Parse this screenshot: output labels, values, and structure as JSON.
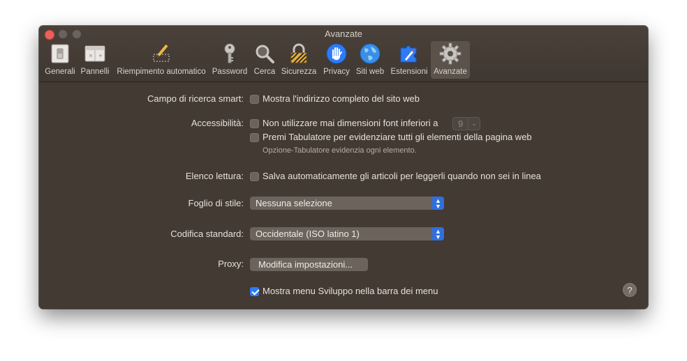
{
  "window": {
    "title": "Avanzate"
  },
  "toolbar": {
    "items": [
      {
        "label": "Generali",
        "icon": "switch-icon"
      },
      {
        "label": "Pannelli",
        "icon": "tabs-window-icon"
      },
      {
        "label": "Riempimento automatico",
        "icon": "pencil-form-icon"
      },
      {
        "label": "Password",
        "icon": "key-icon"
      },
      {
        "label": "Cerca",
        "icon": "magnifier-icon"
      },
      {
        "label": "Sicurezza",
        "icon": "padlock-icon"
      },
      {
        "label": "Privacy",
        "icon": "hand-icon"
      },
      {
        "label": "Siti web",
        "icon": "globe-icon"
      },
      {
        "label": "Estensioni",
        "icon": "puzzle-icon"
      },
      {
        "label": "Avanzate",
        "icon": "gear-icon"
      }
    ],
    "active": "Avanzate"
  },
  "settings": {
    "smart_search": {
      "label": "Campo di ricerca smart:",
      "option": "Mostra l'indirizzo completo del sito web",
      "checked": false
    },
    "accessibility": {
      "label": "Accessibilità:",
      "option_font": "Non utilizzare mai dimensioni font inferiori a",
      "font_size_value": "9",
      "option_font_checked": false,
      "option_tab": "Premi Tabulatore per evidenziare tutti gli elementi della pagina web",
      "option_tab_checked": false,
      "hint": "Opzione-Tabulatore evidenzia ogni elemento."
    },
    "reading_list": {
      "label": "Elenco lettura:",
      "option": "Salva automaticamente gli articoli per leggerli quando non sei in linea",
      "checked": false
    },
    "stylesheet": {
      "label": "Foglio di stile:",
      "value": "Nessuna selezione"
    },
    "encoding": {
      "label": "Codifica standard:",
      "value": "Occidentale (ISO latino 1)"
    },
    "proxy": {
      "label": "Proxy:",
      "button": "Modifica impostazioni..."
    },
    "develop_menu": {
      "option": "Mostra menu Sviluppo nella barra dei menu",
      "checked": true
    },
    "help": "?"
  },
  "colors": {
    "window_bg": "#433a33",
    "accent": "#2f7bf5",
    "close": "#ec5f57"
  }
}
